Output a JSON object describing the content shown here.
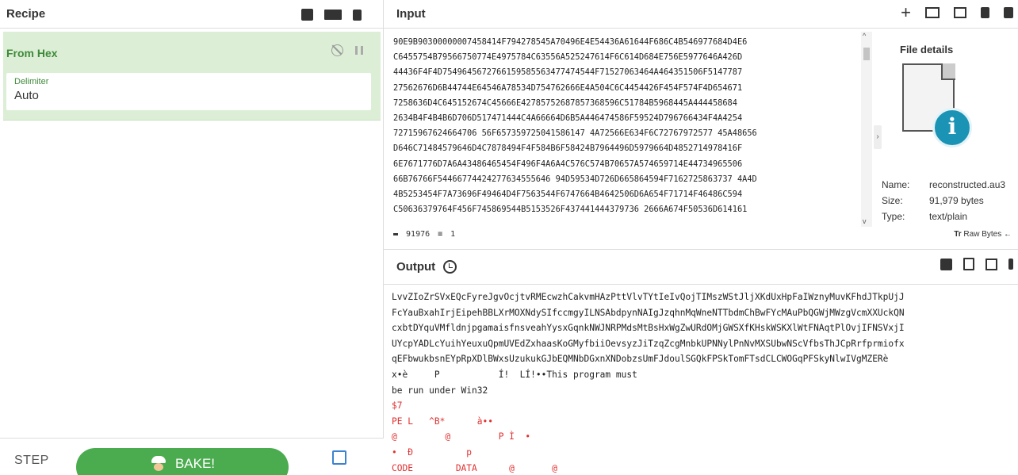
{
  "recipe": {
    "title": "Recipe",
    "operation": {
      "name": "From Hex",
      "delimiter_label": "Delimiter",
      "delimiter_value": "Auto"
    },
    "controls": {
      "step_label": "STEP",
      "bake_label": "BAKE!"
    }
  },
  "input": {
    "title": "Input",
    "hex_lines": [
      "90E9B90300000007458414F794278545A70496E4E54436A61644F686C4B546977684D4E6",
      "C6455754B79566750774E4975784C63556A525247614F6C614D684E756E5977646A426D",
      "44436F4F4D7549645672766159585563477474544F71527063464A464351506F5147787",
      "27562676D6B44744E64546A78534D754762666E4A504C6C4454426F454F574F4D654671",
      "7258636D4C645152674C45666E42785752687857368596C51784B5968445A444458684",
      "2634B4F4B4B6D706D517471444C4A66664D6B5A446474586F59524D796766434F4A4254",
      "72715967624664706 56F657359725041586147 4A72566E634F6C72767972577 45A48656",
      "D646C71484579646D4C7878494F4F584B6F58424B7964496D5979664D4852714978416F",
      "6E7671776D7A6A43486465454F496F4A6A4C576C574B70657A574659714E44734965506",
      "66B76766F54466774424277634555646 94D59534D726D665864594F7162725863737 4A4D",
      "4B5253454F7A73696F49464D4F7563544F6747664B4642506D6A654F71714F46486C594",
      "C50636379764F456F745869544B5153526F437441444379736 2666A674F50536D614161"
    ],
    "status_length": "91976",
    "status_lines": "1",
    "raw_bytes_label": "Raw Bytes",
    "file_details": {
      "title": "File details",
      "name_key": "Name:",
      "name_value": "reconstructed.au3",
      "size_key": "Size:",
      "size_value": "91,979 bytes",
      "type_key": "Type:",
      "type_value": "text/plain"
    }
  },
  "output": {
    "title": "Output",
    "lines": [
      "LvvZIoZrSVxEQcFyreJgvOcjtvRMEcwzhCakvmHAzPttVlvTYtIeIvQojTIMszWStJljXKdUxHpFaIWznyMuvKFhdJTkpUjJ",
      "FcYauBxahIrjEipehBBLXrMOXNdySIfccmgyILNSAbdpynNAIgJzqhnMqWneNTTbdmChBwFYcMAuPbQGWjMWzgVcmXXUckQN",
      "cxbtDYquVMfldnjpgamaisfnsveahYysxGqnkNWJNRPMdsMtBsHxWgZwURdOMjGWSXfKHskWSKXlWtFNAqtPlOvjIFNSVxjI",
      "UYcpYADLcYuihYeuxuQpmUVEdZxhaasKoGMyfbiiOevsyzJiTzqZcgMnbkUPNNylPnNvMXSUbwNScVfbsThJCpRrfprmiofx",
      "qEFbwukbsnEYpRpXDlBWxsUzukukGJbEQMNbDGxnXNDobzsUmFJdoulSGQkFPSkTomFTsdCLCWOGqPFSkyNlwIVgMZERè",
      "x•è     P           Í!  LÍ!••This program must",
      "be run under Win32",
      "$7",
      "PE L   ^B*      à••",
      "@         @         P Ì  •",
      "•  Ð          p",
      "CODE        DATA      @       @"
    ]
  }
}
